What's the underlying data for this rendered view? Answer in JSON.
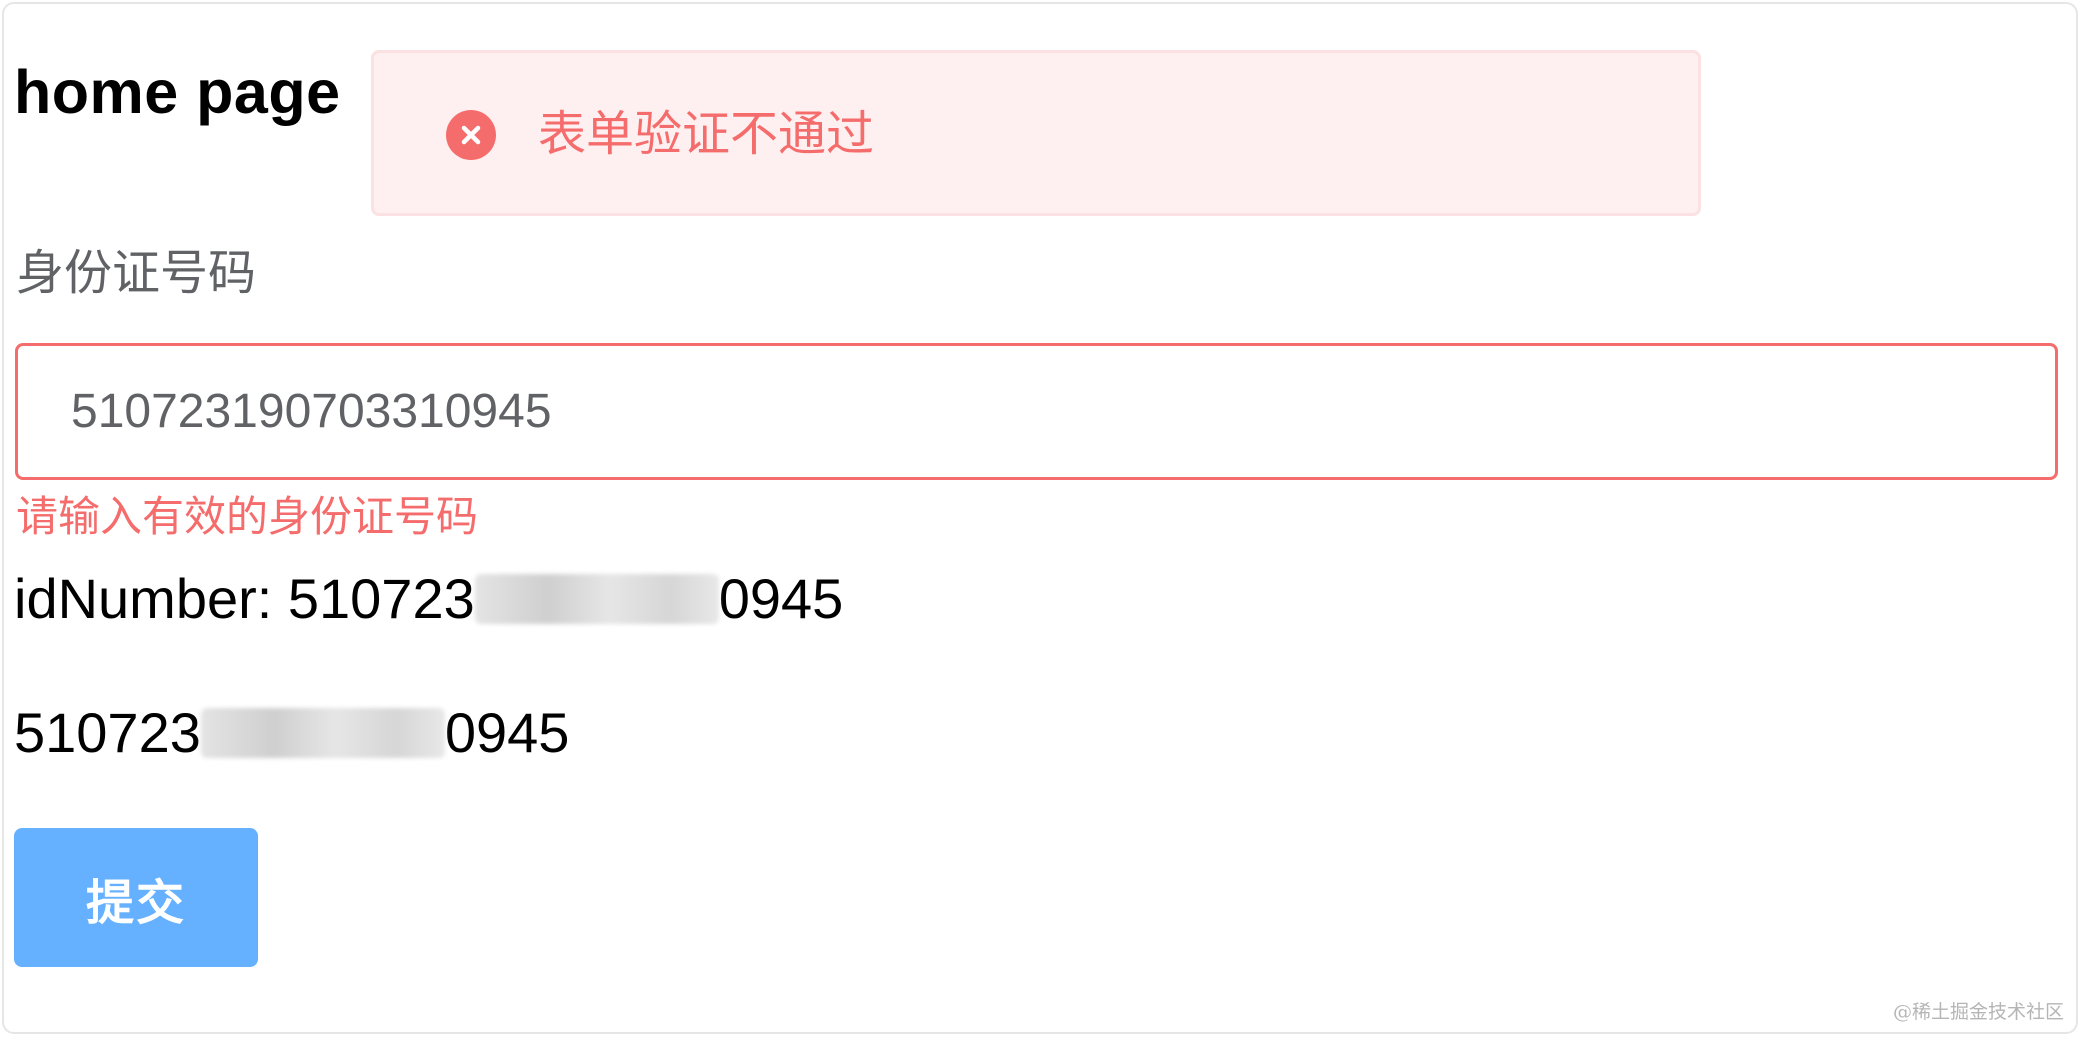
{
  "page": {
    "title": "home page"
  },
  "toast": {
    "icon": "error-circle-icon",
    "message": "表单验证不通过",
    "color": "#f56c6c"
  },
  "form": {
    "id_label": "身份证号码",
    "id_value": "510723190703310945",
    "error_message": "请输入有效的身份证号码",
    "error_color": "#f56c6c",
    "submit_label": "提交",
    "submit_color": "#66b1ff"
  },
  "display": {
    "line1_prefix": "idNumber: 510723",
    "line1_suffix": "0945",
    "line2_prefix": "510723",
    "line2_suffix": "0945"
  },
  "watermark": "@稀土掘金技术社区"
}
